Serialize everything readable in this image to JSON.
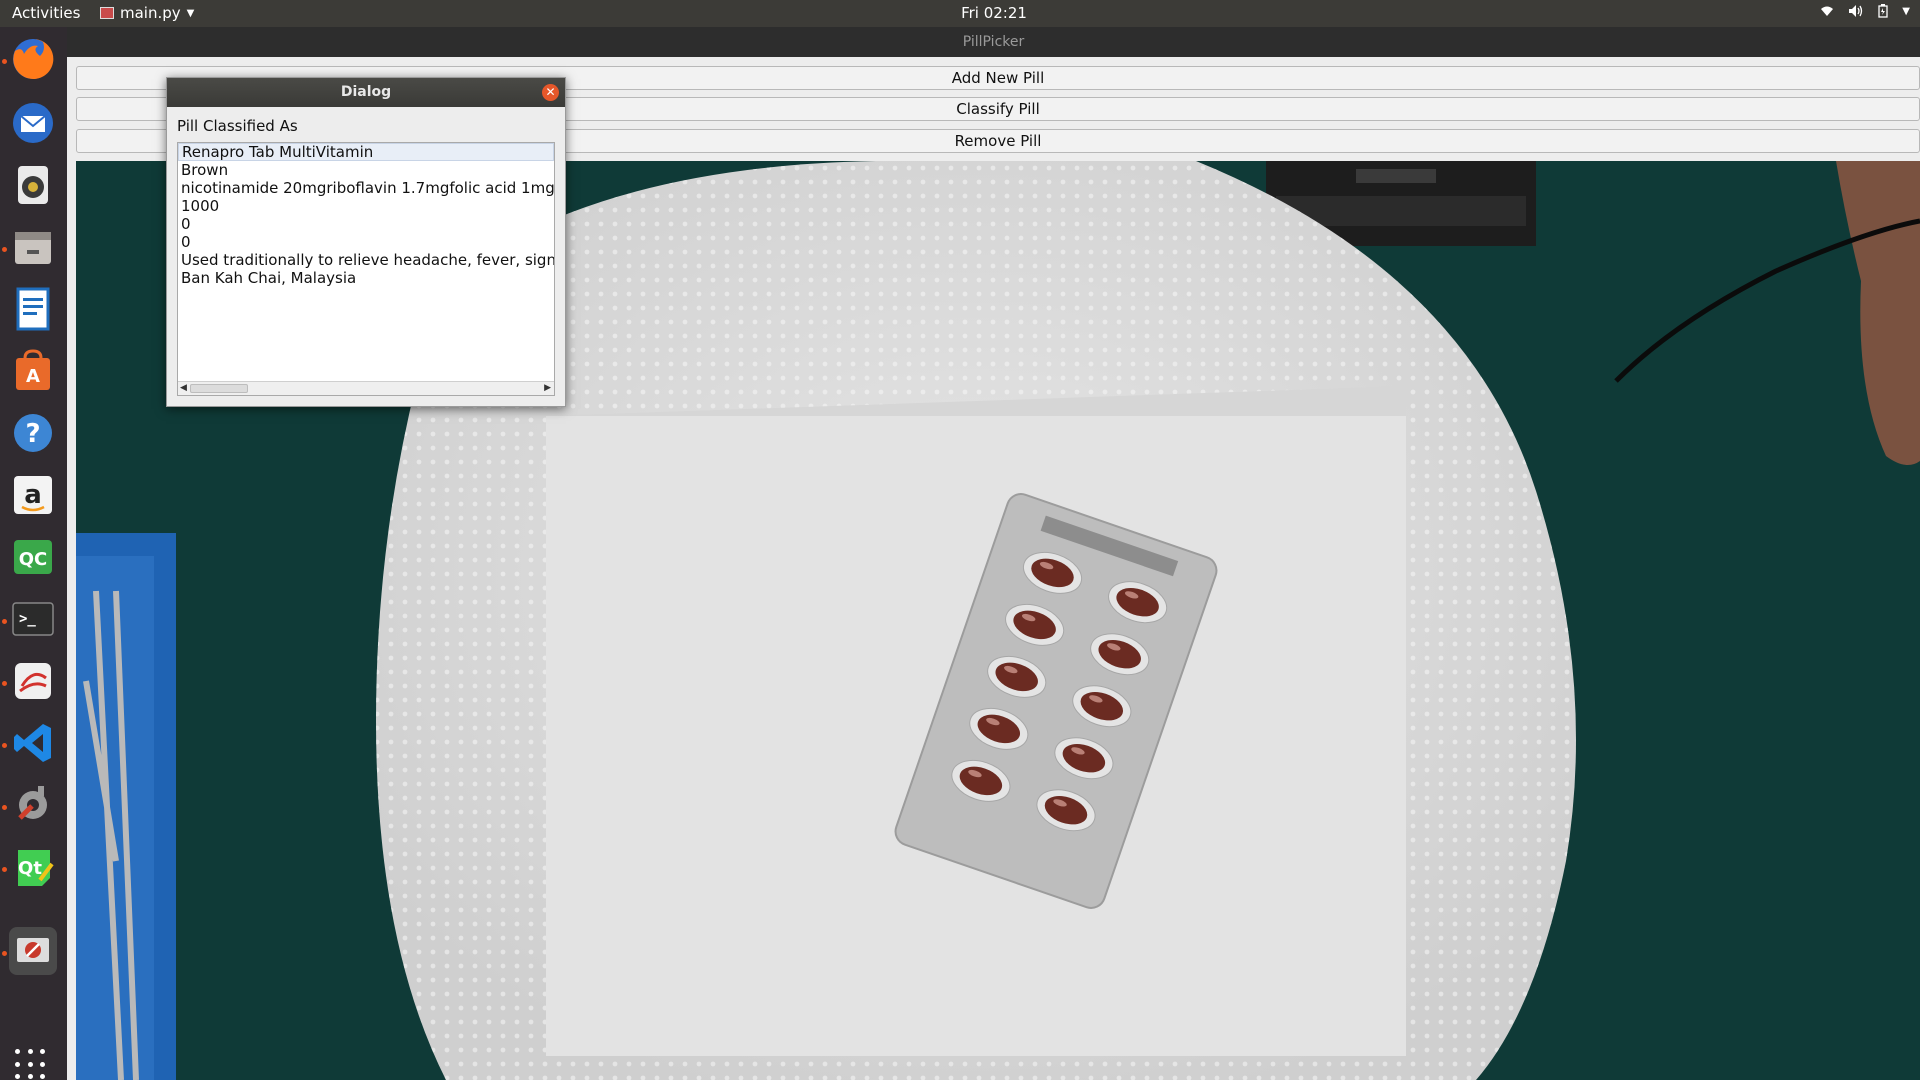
{
  "topbar": {
    "activities": "Activities",
    "app_menu": "main.py",
    "clock": "Fri 02:21",
    "tray": {
      "wifi_icon": "wifi-icon",
      "volume_icon": "volume-icon",
      "battery_icon": "battery-icon",
      "menu_icon": "chevron-down-icon"
    }
  },
  "dock": {
    "items": [
      {
        "name": "firefox",
        "icon": "firefox-icon",
        "running": true
      },
      {
        "name": "thunderbird",
        "icon": "mail-icon",
        "running": false
      },
      {
        "name": "rhythmbox",
        "icon": "speaker-icon",
        "running": false
      },
      {
        "name": "files",
        "icon": "files-icon",
        "running": true
      },
      {
        "name": "libreoffice-writer",
        "icon": "writer-icon",
        "running": false
      },
      {
        "name": "software",
        "icon": "software-store-icon",
        "running": false
      },
      {
        "name": "help",
        "icon": "help-icon",
        "running": false
      },
      {
        "name": "amazon",
        "icon": "amazon-icon",
        "running": false
      },
      {
        "name": "qcad",
        "icon": "qc-icon",
        "running": false
      },
      {
        "name": "terminal",
        "icon": "terminal-icon",
        "running": true
      },
      {
        "name": "eclipse",
        "icon": "eclipse-icon",
        "running": true
      },
      {
        "name": "vscode",
        "icon": "vscode-icon",
        "running": true
      },
      {
        "name": "settings",
        "icon": "settings-icon",
        "running": true
      },
      {
        "name": "qt-creator",
        "icon": "qt-creator-icon",
        "running": true
      },
      {
        "name": "pillpicker",
        "icon": "pillpicker-icon",
        "running": true
      }
    ],
    "show_apps_icon": "app-grid-icon"
  },
  "window": {
    "title": "PillPicker",
    "buttons": {
      "add": "Add New Pill",
      "classify": "Classify Pill",
      "remove": "Remove Pill"
    }
  },
  "dialog": {
    "title": "Dialog",
    "label": "Pill Classified As",
    "rows": [
      "Renapro Tab MultiVitamin",
      "Brown",
      "nicotinamide 20mgriboflavin 1.7mgfolic acid 1mg",
      "1000",
      "0",
      "0",
      "Used traditionally to relieve headache, fever, sign",
      "Ban Kah Chai, Malaysia"
    ],
    "selected_index": 0
  },
  "colors": {
    "topbar": "#3c3b37",
    "dock": "#302b30",
    "close_button": "#e6572a",
    "pill": "#6b2b22",
    "mat": "#0f3a37"
  }
}
